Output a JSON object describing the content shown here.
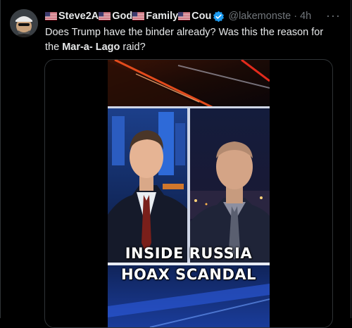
{
  "tweet": {
    "name_parts": [
      "Steve2A",
      "God",
      "Family",
      "Cou"
    ],
    "handle": "@lakemonste",
    "dot": "·",
    "time": "4h",
    "more_label": "···",
    "text_prefix": "Does Trump have the binder already? Was this the reason for the ",
    "text_bold": "Mar-a- Lago",
    "text_suffix": " raid?"
  },
  "video": {
    "caption_line1": "INSIDE RUSSIA",
    "caption_line2": "HOAX SCANDAL"
  },
  "colors": {
    "background": "#000000",
    "text": "#e7e9ea",
    "muted": "#71767b",
    "verified_blue": "#1d9bf0",
    "border": "#2f3336"
  },
  "icons": [
    "us-flag-icon",
    "verified-badge-icon",
    "more-options-icon"
  ]
}
